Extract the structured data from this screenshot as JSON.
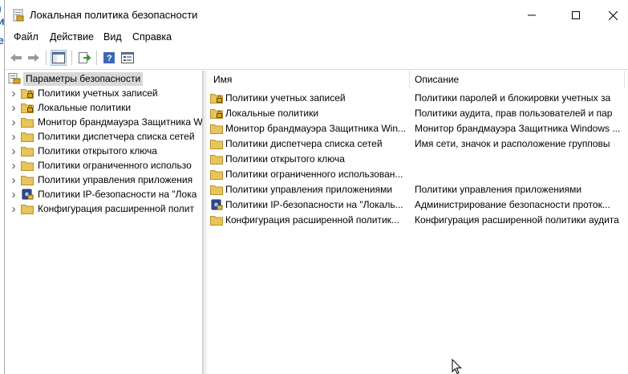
{
  "window": {
    "title": "Локальная политика безопасности"
  },
  "menu": [
    "Файл",
    "Действие",
    "Вид",
    "Справка"
  ],
  "toolbar": {
    "buttons": [
      "back-icon",
      "forward-icon",
      "show-hide-console-tree-icon",
      "export-list-icon",
      "help-icon",
      "properties-icon"
    ]
  },
  "tree": {
    "root": "Параметры безопасности",
    "items": [
      {
        "label": "Политики учетных записей",
        "icon": "lock-folder-icon"
      },
      {
        "label": "Локальные политики",
        "icon": "lock-folder-icon"
      },
      {
        "label": "Монитор брандмауэра Защитника W",
        "icon": "folder-icon"
      },
      {
        "label": "Политики диспетчера списка сетей",
        "icon": "folder-icon"
      },
      {
        "label": "Политики открытого ключа",
        "icon": "folder-icon"
      },
      {
        "label": "Политики ограниченного использо",
        "icon": "folder-icon"
      },
      {
        "label": "Политики управления приложения",
        "icon": "folder-icon"
      },
      {
        "label": "Политики IP-безопасности на \"Лока",
        "icon": "ipsec-icon"
      },
      {
        "label": "Конфигурация расширенной полит",
        "icon": "folder-icon"
      }
    ]
  },
  "list": {
    "columns": {
      "name": "Имя",
      "description": "Описание"
    },
    "rows": [
      {
        "name": "Политики учетных записей",
        "description": "Политики паролей и блокировки учетных за",
        "icon": "lock-folder-icon"
      },
      {
        "name": "Локальные политики",
        "description": "Политики аудита, прав пользователей и пар",
        "icon": "lock-folder-icon"
      },
      {
        "name": "Монитор брандмауэра Защитника Win...",
        "description": "Монитор брандмауэра Защитника Windows ...",
        "icon": "folder-icon"
      },
      {
        "name": "Политики диспетчера списка сетей",
        "description": "Имя сети, значок и расположение групповы",
        "icon": "folder-icon"
      },
      {
        "name": "Политики открытого ключа",
        "description": "",
        "icon": "folder-icon"
      },
      {
        "name": "Политики ограниченного использован...",
        "description": "",
        "icon": "folder-icon"
      },
      {
        "name": "Политики управления приложениями",
        "description": "Политики управления приложениями",
        "icon": "folder-icon"
      },
      {
        "name": "Политики IP-безопасности на \"Локаль...",
        "description": "Администрирование безопасности проток...",
        "icon": "ipsec-icon"
      },
      {
        "name": "Конфигурация расширенной политик...",
        "description": "Конфигурация расширенной политики аудита",
        "icon": "folder-icon"
      }
    ]
  },
  "colors": {
    "folder": "#e8c45c",
    "selection": "#d9d9d9",
    "accent": "#1a5fb4"
  }
}
